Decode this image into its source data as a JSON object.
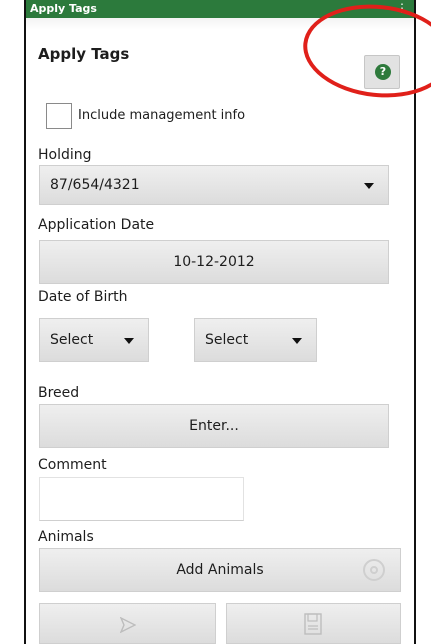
{
  "titlebar": {
    "title": "Apply Tags"
  },
  "header": {
    "title": "Apply Tags",
    "help_icon": "question-icon",
    "accent": "#2c7a3c"
  },
  "management": {
    "label": "Include management info",
    "checked": false
  },
  "holding": {
    "label": "Holding",
    "value": "87/654/4321"
  },
  "application_date": {
    "label": "Application Date",
    "value": "10-12-2012"
  },
  "dob": {
    "label": "Date of Birth",
    "first": "Select",
    "second": "Select"
  },
  "breed": {
    "label": "Breed",
    "button": "Enter..."
  },
  "comment": {
    "label": "Comment",
    "value": ""
  },
  "animals": {
    "label": "Animals",
    "button": "Add Animals",
    "icon": "target-icon"
  },
  "actions": {
    "send_icon": "send-icon",
    "save_icon": "save-icon"
  },
  "annotation": {
    "color": "#e0201a"
  }
}
